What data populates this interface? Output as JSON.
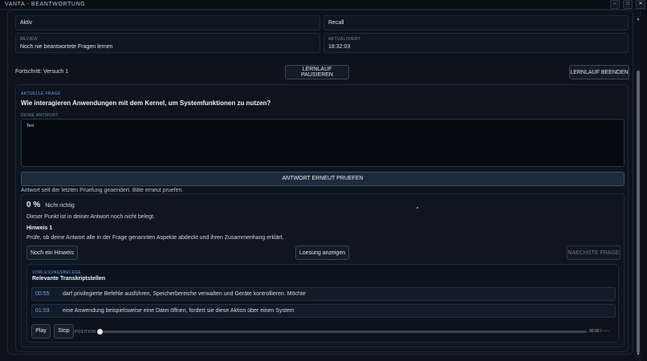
{
  "window": {
    "title": "VANTA - BEANTWORTUNG",
    "controls": {
      "minimize": "–",
      "maximize": "□",
      "close": "✕"
    }
  },
  "info_boxes": {
    "status_value": "Aktiv",
    "mode_value": "Recall",
    "review": {
      "label": "REVIEW",
      "value": "Noch nie beantwortete Fragen lernen"
    },
    "updated": {
      "label": "AKTUALISIERT",
      "value": "18:32:03"
    }
  },
  "progress": {
    "text": "Fortschritt: Versuch 1",
    "pause_label": "LERNLAUF PAUSIEREN",
    "end_label": "LERNLAUF BEENDEN"
  },
  "question": {
    "section_label": "AKTUELLE FRAGE",
    "text": "Wie interagieren Anwendungen mit dem Kernel, um Systemfunktionen zu nutzen?",
    "answer_label": "DEINE ANTWORT",
    "answer_value": "Test",
    "check_label": "ANTWORT ERNEUT PRUEFEN",
    "status_note": "Antwort seit der letzten Pruefung geaendert. Bitte erneut pruefen."
  },
  "feedback": {
    "score": "0 %",
    "verdict": "Nicht richtig",
    "message": "Dieser Punkt ist in deiner Antwort noch nicht belegt.",
    "hint_title": "Hinweis 1",
    "hint_text": "Prüfe, ob deine Antwort alle in der Frage genannten Aspekte abdeckt und ihren Zusammenhang erklärt.",
    "buttons": {
      "more_hint": "Noch ein Hinweis",
      "show_solution": "Loesung anzeigen",
      "next_question": "NAECHSTE FRAGE"
    }
  },
  "transcripts": {
    "section_label": "VORLESUNGSBELEGE",
    "title": "Relevante Transkriptstellen",
    "items": [
      {
        "time": "00:55",
        "text": "darf privilegierte Befehle ausführen, Speicherbereiche verwalten und Geräte kontrollieren. Möchte"
      },
      {
        "time": "01:03",
        "text": "eine Anwendung beispielsweise eine Datei öffnen, fordert sie diese Aktion über einen System"
      }
    ],
    "player": {
      "play_label": "Play",
      "stop_label": "Stop",
      "position_label": "POSITION",
      "time_readout": "00:00 / --:--",
      "position_fraction": 0
    }
  },
  "colors": {
    "accent": "#5ea8ff",
    "background": "#0b1119",
    "panel": "#0d141e"
  }
}
